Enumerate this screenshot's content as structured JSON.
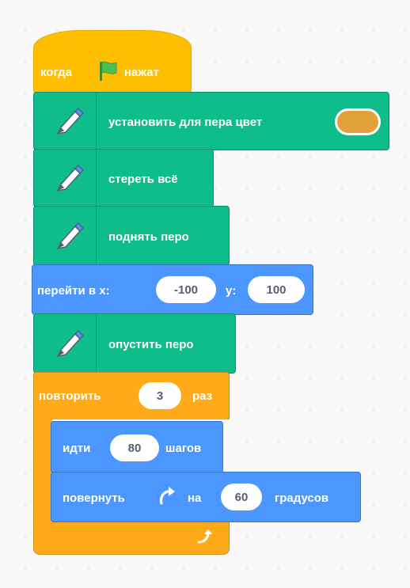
{
  "colors": {
    "events": "#ffbf00",
    "events_border": "#e6ac00",
    "control": "#ffab19",
    "pen": "#0fbd8c",
    "pen_border": "#0b8e69",
    "motion": "#4c97ff",
    "motion_border": "#3373cc",
    "pen_color_swatch": "#e0a13a"
  },
  "blocks": {
    "when_flag": {
      "pre": "когда",
      "post": "нажат",
      "icon": "green-flag-icon"
    },
    "set_pen_color": {
      "label": "установить для пера цвет",
      "icon": "pen-icon"
    },
    "erase_all": {
      "label": "стереть всё",
      "icon": "pen-icon"
    },
    "pen_up": {
      "label": "поднять перо",
      "icon": "pen-icon"
    },
    "goto_xy": {
      "label": "перейти в x:",
      "x_value": "-100",
      "y_label": "y:",
      "y_value": "100"
    },
    "pen_down": {
      "label": "опустить перо",
      "icon": "pen-icon"
    },
    "repeat": {
      "label": "повторить",
      "times": "3",
      "suffix": "раз",
      "icon": "loop-arrow-icon"
    },
    "move": {
      "label": "идти",
      "steps": "80",
      "suffix": "шагов"
    },
    "turn": {
      "label": "повернуть",
      "on": "на",
      "degrees": "60",
      "suffix": "градусов",
      "icon": "rotate-right-icon"
    }
  }
}
